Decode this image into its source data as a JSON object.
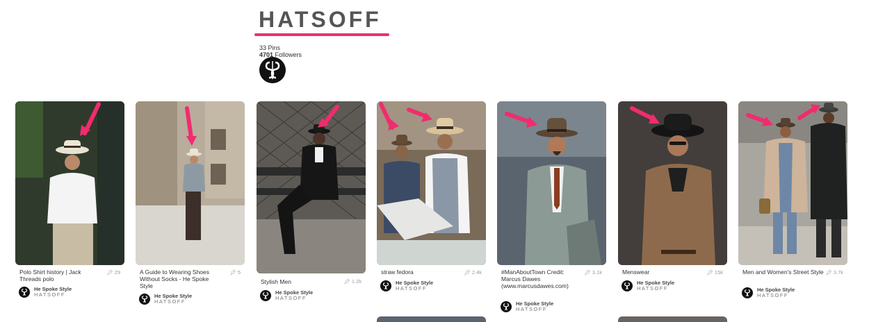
{
  "board": {
    "title": "HATSOFF",
    "pins_count": "33",
    "pins_label": "Pins",
    "followers_count": "4701",
    "followers_label": "Followers",
    "accent_color": "#e8336d",
    "avatar_icon": "hs-monogram-icon"
  },
  "pins": [
    {
      "description": "Polo Shirt history | Jack Threads polo",
      "repins": "29",
      "user": "He Spoke Style",
      "board": "HATSOFF"
    },
    {
      "description": "A Guide to Wearing Shoes Without Socks - He Spoke Style",
      "repins": "5",
      "user": "He Spoke Style",
      "board": "HATSOFF"
    },
    {
      "description": "Stylish Men",
      "repins": "1.2k",
      "user": "He Spoke Style",
      "board": "HATSOFF"
    },
    {
      "description": "straw fedora",
      "repins": "2.4k",
      "user": "He Spoke Style",
      "board": "HATSOFF"
    },
    {
      "description": "#ManAboutTown Credit: Marcus Dawes (www.marcusdawes.com)",
      "repins": "3.1k",
      "user": "He Spoke Style",
      "board": "HATSOFF"
    },
    {
      "description": "Menswear",
      "repins": "15k",
      "user": "He Spoke Style",
      "board": "HATSOFF"
    },
    {
      "description": "Men and Women's Street Style",
      "repins": "3.7k",
      "user": "He Spoke Style",
      "board": "HATSOFF"
    }
  ]
}
